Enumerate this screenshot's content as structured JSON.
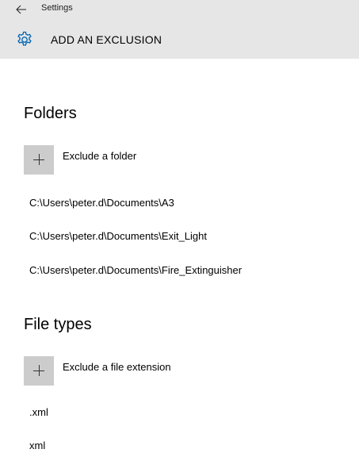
{
  "header": {
    "back_label": "Settings",
    "title": "ADD AN EXCLUSION",
    "icons": {
      "back": "back-arrow-icon",
      "gear": "gear-icon"
    },
    "background": "#e6e6e6"
  },
  "folders": {
    "title": "Folders",
    "add_label": "Exclude a folder",
    "items": [
      "C:\\Users\\peter.d\\Documents\\A3",
      "C:\\Users\\peter.d\\Documents\\Exit_Light",
      "C:\\Users\\peter.d\\Documents\\Fire_Extinguisher"
    ]
  },
  "file_types": {
    "title": "File types",
    "add_label": "Exclude a file extension",
    "items": [
      ".xml",
      "xml"
    ]
  },
  "colors": {
    "header_bg": "#e6e6e6",
    "plus_box": "#cccccc",
    "gear_accent": "#0063b1"
  }
}
